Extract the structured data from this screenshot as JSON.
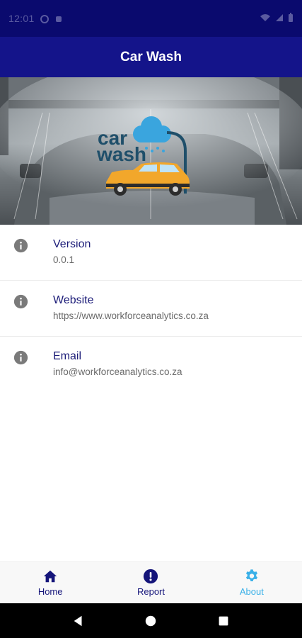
{
  "status_bar": {
    "time": "12:01"
  },
  "app_bar": {
    "title": "Car Wash"
  },
  "hero": {
    "logo_line1": "car",
    "logo_line2": "wash"
  },
  "about_items": [
    {
      "title": "Version",
      "value": "0.0.1",
      "icon": "info-icon"
    },
    {
      "title": "Website",
      "value": "https://www.workforceanalytics.co.za",
      "icon": "info-icon"
    },
    {
      "title": "Email",
      "value": "info@workforceanalytics.co.za",
      "icon": "info-icon"
    }
  ],
  "bottom_nav": {
    "items": [
      {
        "label": "Home",
        "icon": "home-icon"
      },
      {
        "label": "Report",
        "icon": "alert-icon"
      },
      {
        "label": "About",
        "icon": "gear-icon"
      }
    ],
    "active_index": 2
  },
  "colors": {
    "status_bar": "#0a0a6e",
    "app_bar": "#14148a",
    "primary_text": "#1c1c78",
    "active_tab": "#3ab0e8",
    "logo_teal": "#1f4f6a",
    "logo_cloud": "#3aa5de",
    "car_yellow": "#f2a72b"
  }
}
